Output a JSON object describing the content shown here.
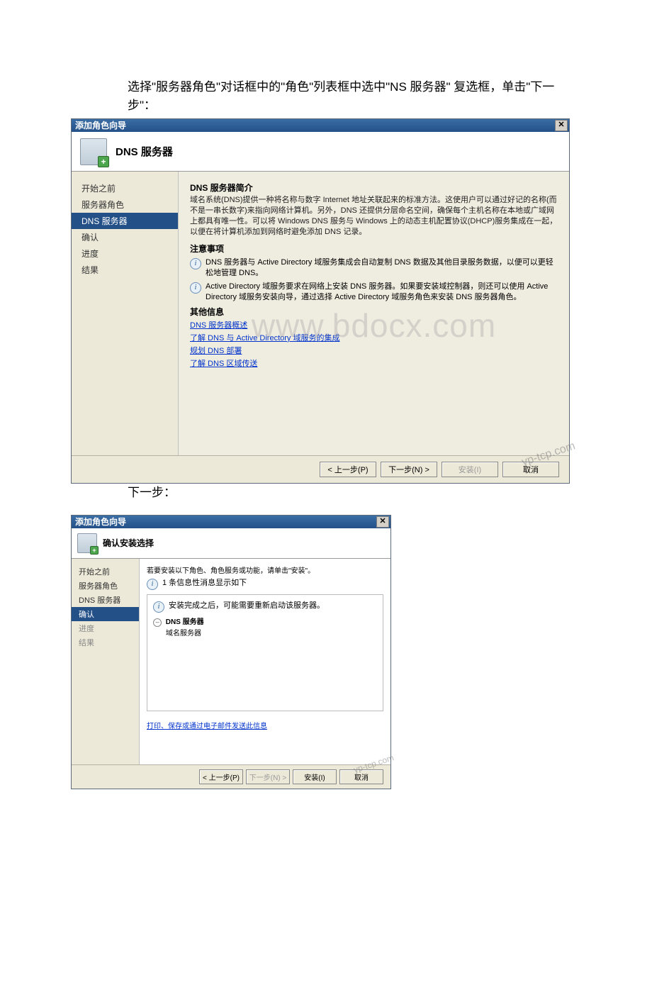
{
  "doc": {
    "instruction1": "选择\"服务器角色\"对话框中的\"角色\"列表框中选中\"NS 服务器\" 复选框，单击\"下一步\"：",
    "instruction2": "下一步："
  },
  "watermark": {
    "center": "www.bdocx.com",
    "corner": "yp-tcp.com"
  },
  "dialog1": {
    "title": "添加角色向导",
    "header": "DNS 服务器",
    "sidebar": [
      {
        "label": "开始之前",
        "state": "normal"
      },
      {
        "label": "服务器角色",
        "state": "normal"
      },
      {
        "label": "DNS 服务器",
        "state": "selected"
      },
      {
        "label": "确认",
        "state": "normal"
      },
      {
        "label": "进度",
        "state": "normal"
      },
      {
        "label": "结果",
        "state": "normal"
      }
    ],
    "section_intro_h": "DNS 服务器简介",
    "section_intro_body": "域名系统(DNS)提供一种将名称与数字 Internet 地址关联起来的标准方法。这使用户可以通过好记的名称(而不是一串长数字)来指向网络计算机。另外，DNS 还提供分层命名空间，确保每个主机名称在本地或广域网上都具有唯一性。可以将 Windows DNS 服务与 Windows 上的动态主机配置协议(DHCP)服务集成在一起，以便在将计算机添加到网络时避免添加 DNS 记录。",
    "section_notes_h": "注意事项",
    "note1": "DNS 服务器与 Active Directory 域服务集成会自动复制 DNS 数据及其他目录服务数据，以便可以更轻松地管理 DNS。",
    "note2": "Active Directory 域服务要求在网络上安装 DNS 服务器。如果要安装域控制器，则还可以使用 Active Directory 域服务安装向导，通过选择 Active Directory 域服务角色来安装 DNS 服务器角色。",
    "section_other_h": "其他信息",
    "links": [
      "DNS 服务器概述",
      "了解 DNS 与 Active Directory 域服务的集成",
      "规划 DNS 部署",
      "了解 DNS 区域传送"
    ],
    "buttons": {
      "prev": "< 上一步(P)",
      "next": "下一步(N) >",
      "install": "安装(I)",
      "cancel": "取消"
    }
  },
  "dialog2": {
    "title": "添加角色向导",
    "header": "确认安装选择",
    "sidebar": [
      {
        "label": "开始之前",
        "state": "normal"
      },
      {
        "label": "服务器角色",
        "state": "normal"
      },
      {
        "label": "DNS 服务器",
        "state": "normal"
      },
      {
        "label": "确认",
        "state": "selected"
      },
      {
        "label": "进度",
        "state": "disabled"
      },
      {
        "label": "结果",
        "state": "disabled"
      }
    ],
    "line1": "若要安装以下角色、角色服务或功能，请单击\"安装\"。",
    "line2": "1 条信息性消息显示如下",
    "warn": "安装完成之后，可能需要重新启动该服务器。",
    "role_h": "DNS 服务器",
    "role_sub": "域名服务器",
    "print_link": "打印、保存或通过电子邮件发送此信息",
    "buttons": {
      "prev": "< 上一步(P)",
      "next": "下一步(N) >",
      "install": "安装(I)",
      "cancel": "取消"
    }
  }
}
